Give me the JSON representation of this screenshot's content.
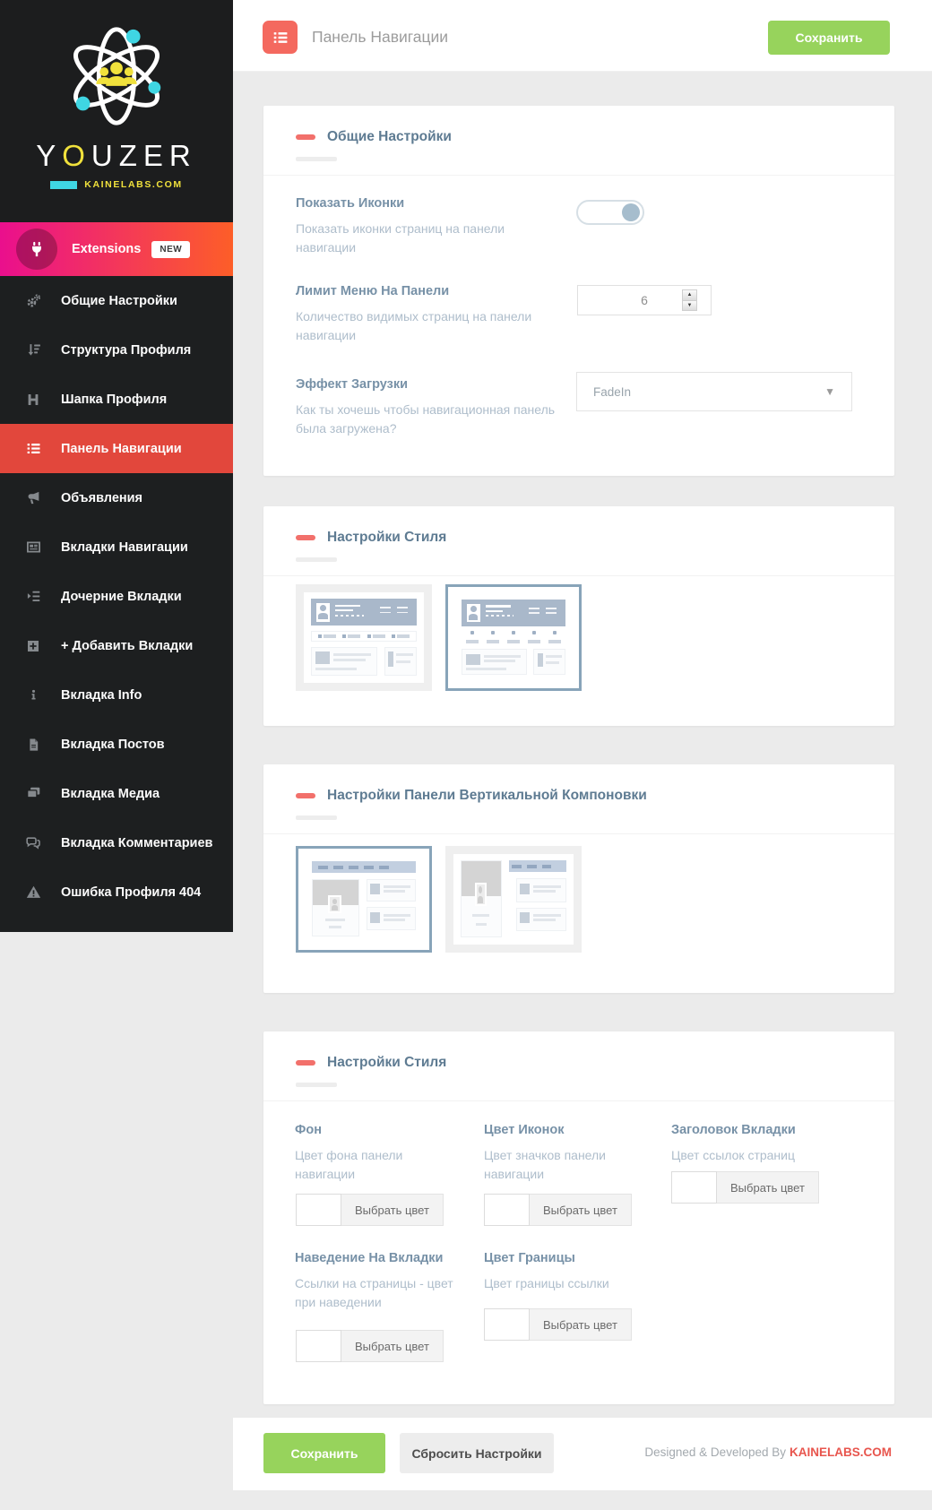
{
  "colors": {
    "sidebar_bg": "#1d1f20",
    "active_item_red": "#e2473c",
    "extensions_gradient_start": "#ea0f8d",
    "extensions_gradient_end": "#fd5e28",
    "section_accent_red": "#f2706b",
    "header_icon_red": "#f4695f",
    "save_green": "#97d35c",
    "brand_yellow": "#f0e13c",
    "brand_cyan": "#3fd6e3",
    "label_blue": "#7791a7",
    "credit_red": "#e8554d"
  },
  "sidebar": {
    "brand": {
      "part1": "Y",
      "part2": "O",
      "part3": "UZER",
      "subtitle": "KAINELABS.COM"
    },
    "extensions": {
      "label": "Extensions",
      "badge": "NEW"
    },
    "items": [
      {
        "label": "Общие Настройки"
      },
      {
        "label": "Структура Профиля"
      },
      {
        "label": "Шапка Профиля"
      },
      {
        "label": "Панель Навигации"
      },
      {
        "label": "Объявления"
      },
      {
        "label": "Вкладки Навигации"
      },
      {
        "label": "Дочерние Вкладки"
      },
      {
        "label": "+ Добавить Вкладки"
      },
      {
        "label": "Вкладка Info"
      },
      {
        "label": "Вкладка Постов"
      },
      {
        "label": "Вкладка Медиа"
      },
      {
        "label": "Вкладка Комментариев"
      },
      {
        "label": "Ошибка Профиля 404"
      }
    ]
  },
  "header": {
    "title": "Панель Навигации",
    "save_label": "Сохранить"
  },
  "general": {
    "title": "Общие Настройки",
    "show_icons": {
      "label": "Показать Иконки",
      "desc": "Показать иконки страниц на панели навигации",
      "enabled": true
    },
    "menu_limit": {
      "label": "Лимит Меню На Панели",
      "desc": "Количество видимых страниц на панели навигации",
      "value": "6"
    },
    "load_effect": {
      "label": "Эффект Загрузки",
      "desc": "Как ты хочешь чтобы навигационная панель была загружена?",
      "value": "FadeIn"
    }
  },
  "style": {
    "title": "Настройки Стиля"
  },
  "vertical": {
    "title": "Настройки Панели Вертикальной Компоновки"
  },
  "style_colors": {
    "title": "Настройки Стиля",
    "button_label": "Выбрать цвет",
    "pickers": [
      {
        "label": "Фон",
        "desc": "Цвет фона панели навигации"
      },
      {
        "label": "Цвет Иконок",
        "desc": "Цвет значков панели навигации"
      },
      {
        "label": "Заголовок Вкладки",
        "desc": "Цвет ссылок страниц"
      },
      {
        "label": "Наведение На Вкладки",
        "desc": "Ссылки на страницы - цвет при наведении"
      },
      {
        "label": "Цвет Границы",
        "desc": "Цвет границы ссылки"
      }
    ]
  },
  "footer": {
    "save_label": "Сохранить",
    "reset_label": "Сбросить Настройки",
    "credit_prefix": "Designed & Developed By",
    "credit_brand": "KAINELABS.COM"
  }
}
